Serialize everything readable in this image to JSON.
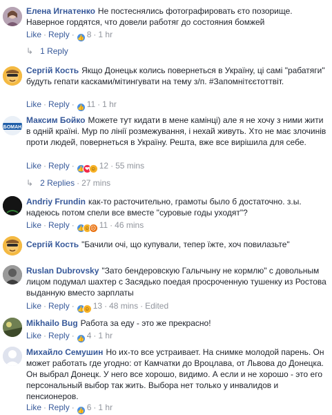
{
  "actions": {
    "like": "Like",
    "reply": "Reply",
    "sep": "·"
  },
  "comments": [
    {
      "author": "Елена Игнатенко",
      "text": "Не постеснялись фотографировать єто позорище. Наверное гордятся, что довели работяг до состояния бомжей",
      "count": "8",
      "time": "1 hr",
      "edited": ""
    },
    {
      "author": "Сергій Кость",
      "text": "Якщо Донецьк колись повернеться в Україну, ці самі \"рабатяги\" будуть гепати касками/мітингувати на тему з/п. #Запомнітєєтоттвіт.",
      "count": "11",
      "time": "1 hr",
      "edited": ""
    },
    {
      "author": "Максим Бойко",
      "text": "Можете тут кидати в мене камінці) але я не хочу з ними жити в одній країні. Мур по лінії розмежування, і нехай живуть. Хто не має злочинів проти людей, повернеться в Україну. Решта, вже все вирішила для себе.",
      "count": "12",
      "time": "55 mins",
      "edited": ""
    },
    {
      "author": "Andriy Frundin",
      "text": "как-то расточительно, грамоты было б достаточно. з.ы. надеюсь потом спели все вместе \"суровые годы уходят\"?",
      "count": "11",
      "time": "46 mins",
      "edited": ""
    },
    {
      "author": "Сергій Кость",
      "text": "\"Бачили очі, що купували, тепер їжте, хоч повилазьте\"",
      "count": "",
      "time": "",
      "edited": ""
    },
    {
      "author": "Ruslan Dubrovsky",
      "text": "\"Зато бендеровскую Галычыну не кормлю\" с довольным лицом подумал шахтер с Засядько поедая просроченную тушенку из Ростова выданную вместо зарплаты",
      "count": "13",
      "time": "48 mins",
      "edited": "Edited"
    },
    {
      "author": "Mikhailo Bug",
      "text": "Работа за еду - это же прекрасно!",
      "count": "4",
      "time": "1 hr",
      "edited": ""
    },
    {
      "author": "Михайло Семушин",
      "text": "Но их-то все устраивает. На снимке молодой парень. Он может работать где угодно: от Камчатки до Вроцлава, от Львова до Донецка. Он выбрал Донецк. У него все хорошо, видимо. А если и не хорошо - это его персональный выбор так жить. Выбора нет только у инвалидов и пенсионеров.",
      "count": "6",
      "time": "1 hr",
      "edited": ""
    }
  ],
  "replies": [
    {
      "label": "1 Reply",
      "time": ""
    },
    {
      "label": "2 Replies",
      "time": "27 mins"
    }
  ],
  "avatar_badge": "БОМАН"
}
